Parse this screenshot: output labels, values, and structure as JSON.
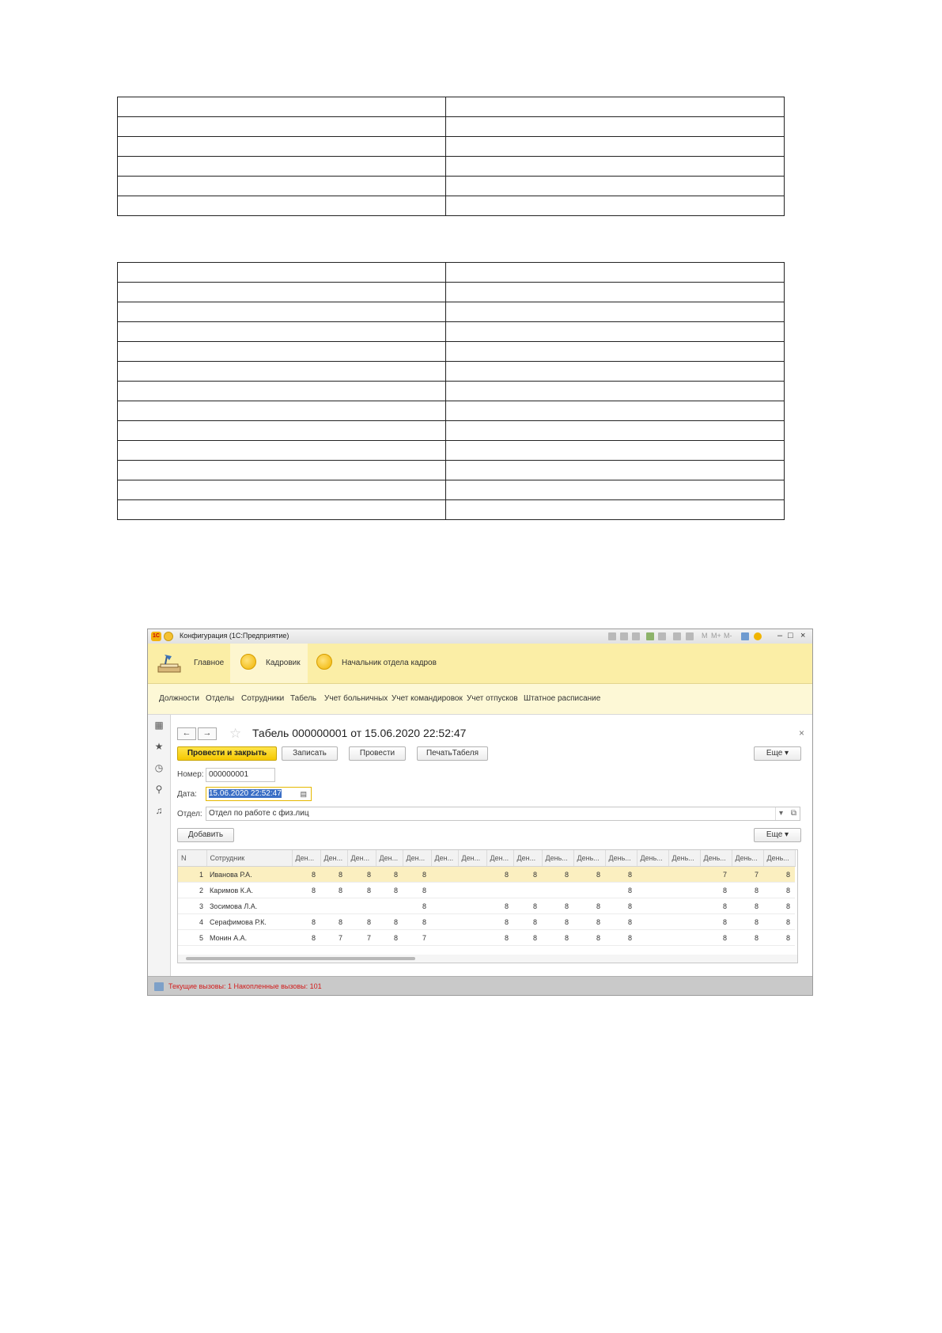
{
  "window": {
    "title": "Конфигурация (1С:Предприятие)",
    "toolbar_labels": [
      "M",
      "M+",
      "M-"
    ],
    "minimize": "–",
    "restore": "□",
    "close": "×"
  },
  "sections": [
    {
      "label": "Главное"
    },
    {
      "label": "Кадровик"
    },
    {
      "label": "Начальник отдела кадров"
    }
  ],
  "nav": [
    "Должности",
    "Отделы",
    "Сотрудники",
    "Табель",
    "Учет больничных",
    "Учет командировок",
    "Учет отпусков",
    "Штатное расписание"
  ],
  "left_panel_icons": [
    "apps-grid-icon",
    "star-icon",
    "history-icon",
    "search-icon",
    "bell-icon"
  ],
  "form": {
    "back": "←",
    "forward": "→",
    "title": "Табель 000000001 от 15.06.2020 22:52:47",
    "close": "×",
    "buttons": {
      "post_close": "Провести и закрыть",
      "save": "Записать",
      "post": "Провести",
      "print": "ПечатьТабеля",
      "more": "Еще"
    },
    "number_label": "Номер:",
    "number_value": "000000001",
    "date_label": "Дата:",
    "date_value": "15.06.2020 22:52:47",
    "dept_label": "Отдел:",
    "dept_value": "Отдел по работе с физ.лиц",
    "add_button": "Добавить",
    "table_more": "Еще"
  },
  "table": {
    "columns": [
      "N",
      "Сотрудник",
      "Ден...",
      "Ден...",
      "Ден...",
      "Ден...",
      "Ден...",
      "Ден...",
      "Ден...",
      "Ден...",
      "Ден...",
      "День...",
      "День...",
      "День...",
      "День...",
      "День...",
      "День...",
      "День...",
      "День..."
    ],
    "rows": [
      [
        "1",
        "Иванова Р.А.",
        "8",
        "8",
        "8",
        "8",
        "8",
        "",
        "",
        "8",
        "8",
        "8",
        "8",
        "8",
        "",
        "",
        "7",
        "7",
        "8"
      ],
      [
        "2",
        "Каримов К.А.",
        "8",
        "8",
        "8",
        "8",
        "8",
        "",
        "",
        "",
        "",
        "",
        "",
        "8",
        "",
        "",
        "8",
        "8",
        "8"
      ],
      [
        "3",
        "Зосимова Л.А.",
        "",
        "",
        "",
        "",
        "8",
        "",
        "",
        "8",
        "8",
        "8",
        "8",
        "8",
        "",
        "",
        "8",
        "8",
        "8"
      ],
      [
        "4",
        "Серафимова Р.К.",
        "8",
        "8",
        "8",
        "8",
        "8",
        "",
        "",
        "8",
        "8",
        "8",
        "8",
        "8",
        "",
        "",
        "8",
        "8",
        "8"
      ],
      [
        "5",
        "Монин А.А.",
        "8",
        "7",
        "7",
        "8",
        "7",
        "",
        "",
        "8",
        "8",
        "8",
        "8",
        "8",
        "",
        "",
        "8",
        "8",
        "8"
      ]
    ]
  },
  "status": "Текущие вызовы: 1   Накопленные вызовы: 101",
  "colors": {
    "sections_bg": "#fbeea6",
    "nav_bg": "#fdf8d6",
    "primary_button": "#f5c800",
    "selected_row": "#fbefc0",
    "status_text": "#d21c1c"
  }
}
